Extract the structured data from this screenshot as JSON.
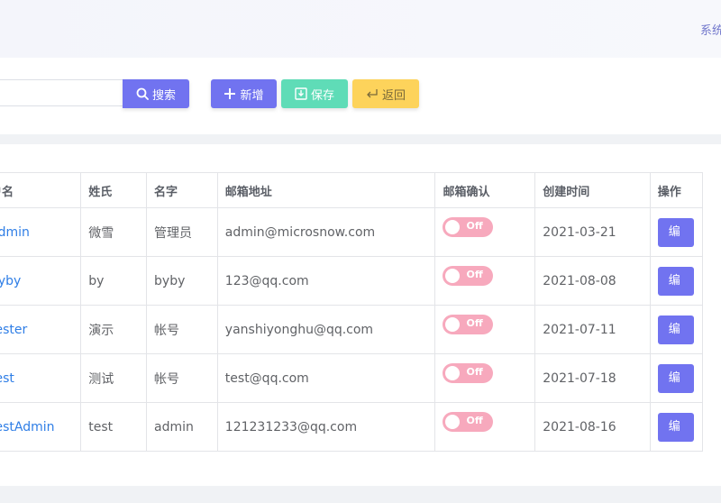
{
  "header": {
    "system_text": "系统"
  },
  "toolbar": {
    "search_placeholder": "",
    "search_label": "搜索",
    "add_label": "新增",
    "save_label": "保存",
    "back_label": "返回"
  },
  "table": {
    "headers": {
      "username": "户名",
      "surname": "姓氏",
      "given_name": "名字",
      "email": "邮箱地址",
      "email_confirmed": "邮箱确认",
      "created": "创建时间",
      "actions": "操作"
    },
    "rows": [
      {
        "username": "admin",
        "surname": "微雪",
        "given_name": "管理员",
        "email": "admin@microsnow.com",
        "email_confirmed": "Off",
        "created": "2021-03-21",
        "edit": "编"
      },
      {
        "username": "byby",
        "surname": "by",
        "given_name": "byby",
        "email": "123@qq.com",
        "email_confirmed": "Off",
        "created": "2021-08-08",
        "edit": "编"
      },
      {
        "username": "tester",
        "surname": "演示",
        "given_name": "帐号",
        "email": "yanshiyonghu@qq.com",
        "email_confirmed": "Off",
        "created": "2021-07-11",
        "edit": "编"
      },
      {
        "username": "test",
        "surname": "测试",
        "given_name": "帐号",
        "email": "test@qq.com",
        "email_confirmed": "Off",
        "created": "2021-07-18",
        "edit": "编"
      },
      {
        "username": "testAdmin",
        "surname": "test",
        "given_name": "admin",
        "email": "121231233@qq.com",
        "email_confirmed": "Off",
        "created": "2021-08-16",
        "edit": "编"
      }
    ]
  },
  "colors": {
    "primary": "#7173f0",
    "success": "#5fdcb7",
    "warning": "#fdd35b",
    "switch_off": "#f7a9bd",
    "link": "#2f7ee6"
  },
  "icons": {
    "search": "search-icon",
    "add": "plus-icon",
    "save": "save-icon",
    "back": "return-arrow-icon"
  }
}
